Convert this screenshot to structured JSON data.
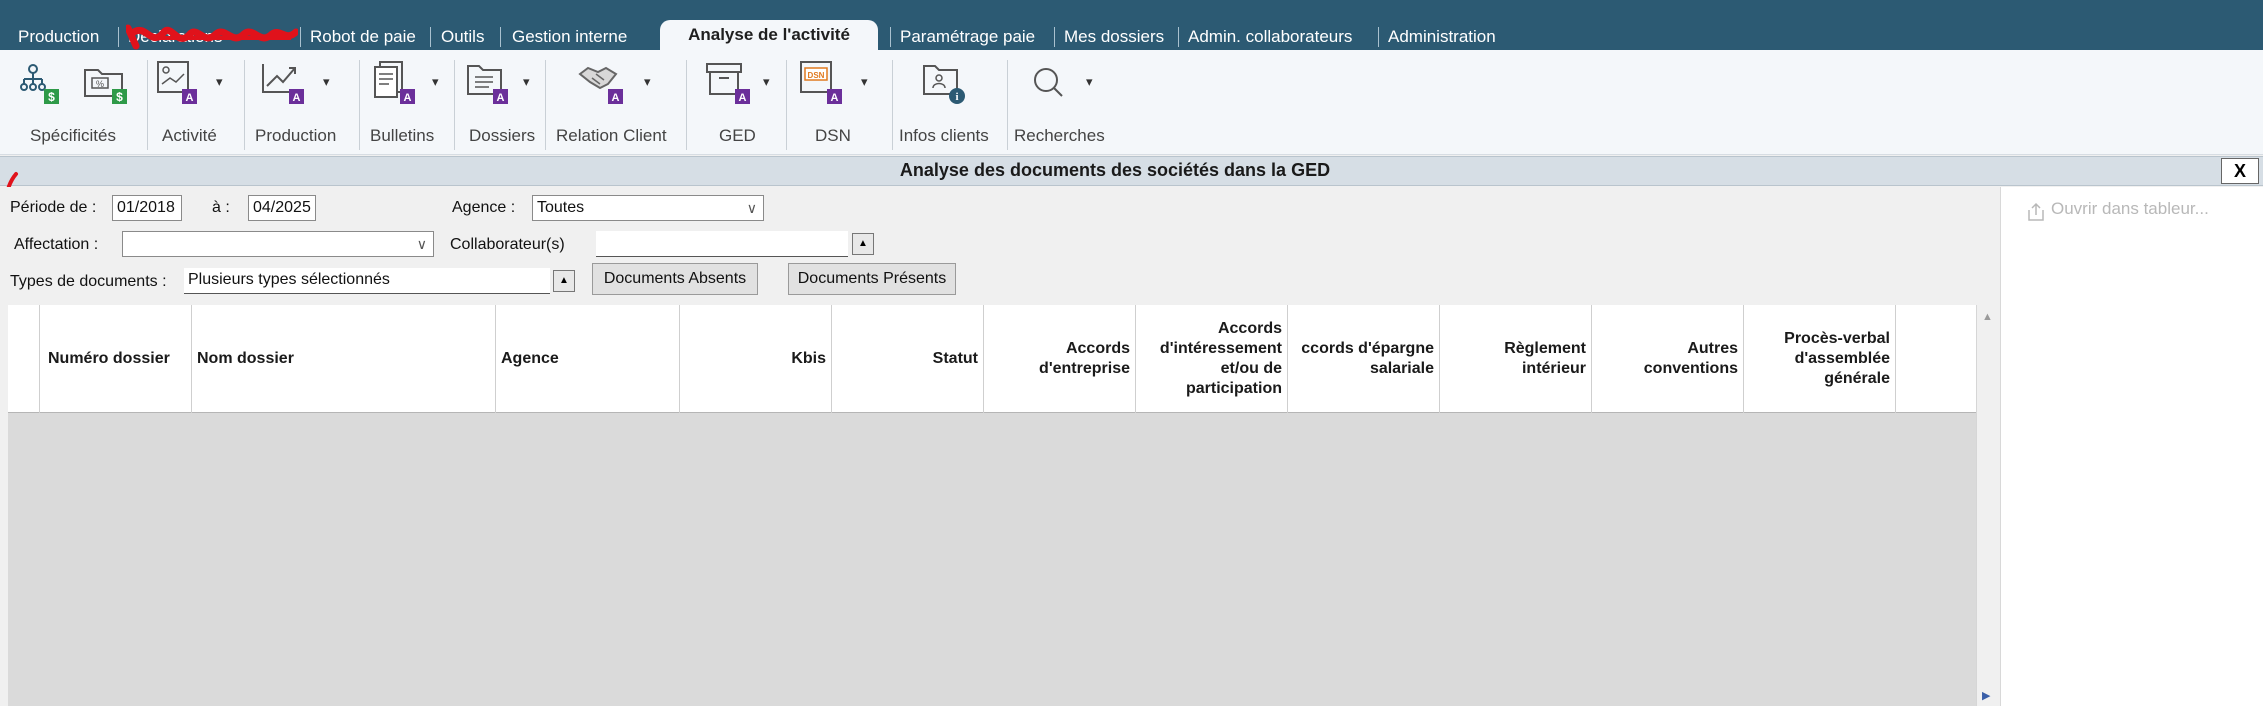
{
  "tabs": [
    {
      "label": "Production",
      "active": false
    },
    {
      "label": "Déclarations",
      "active": false
    },
    {
      "label": "Robot de paie",
      "active": false
    },
    {
      "label": "Outils",
      "active": false
    },
    {
      "label": "Gestion interne",
      "active": false
    },
    {
      "label": "Analyse de l'activité",
      "active": true
    },
    {
      "label": "Paramétrage paie",
      "active": false
    },
    {
      "label": "Mes dossiers",
      "active": false
    },
    {
      "label": "Admin. collaborateurs",
      "active": false
    },
    {
      "label": "Administration",
      "active": false
    }
  ],
  "ribbon": [
    {
      "label": "Spécificités",
      "icons": [
        "org-chart-icon",
        "folder-percent-icon"
      ]
    },
    {
      "label": "Activité",
      "icons": [
        "activity-report-icon"
      ]
    },
    {
      "label": "Production",
      "icons": [
        "chart-line-icon"
      ]
    },
    {
      "label": "Bulletins",
      "icons": [
        "payslip-icon"
      ]
    },
    {
      "label": "Dossiers",
      "icons": [
        "folder-list-icon"
      ]
    },
    {
      "label": "Relation Client",
      "icons": [
        "handshake-icon"
      ]
    },
    {
      "label": "GED",
      "icons": [
        "archive-box-icon"
      ]
    },
    {
      "label": "DSN",
      "icons": [
        "dsn-icon"
      ]
    },
    {
      "label": "Infos clients",
      "icons": [
        "client-info-icon"
      ]
    },
    {
      "label": "Recherches",
      "icons": [
        "search-icon"
      ]
    }
  ],
  "badges": {
    "dollar": "$",
    "admin": "A"
  },
  "title": "Analyse des documents des sociétés dans la GED",
  "close_label": "X",
  "filters": {
    "periode_label": "Période de :",
    "periode_from": "01/2018",
    "a_label": "à :",
    "periode_to": "04/2025",
    "agence_label": "Agence :",
    "agence_value": "Toutes",
    "affectation_label": "Affectation :",
    "affectation_value": "",
    "collaborateurs_label": "Collaborateur(s)",
    "collaborateurs_value": "",
    "types_label": "Types de documents :",
    "types_value": "Plusieurs types sélectionnés",
    "btn_absents": "Documents Absents",
    "btn_presents": "Documents Présents"
  },
  "table": {
    "columns": [
      "",
      "Numéro dossier",
      "Nom dossier",
      "Agence",
      "Kbis",
      "Statut",
      "Accords\nd'entreprise",
      "Accords\nd'intéressement\net/ou de\nparticipation",
      "ccords d'épargne\nsalariale",
      "Règlement\nintérieur",
      "Autres\nconventions",
      "Procès-verbal\nd'assemblée\ngénérale",
      ""
    ],
    "rows": []
  },
  "side_panel": {
    "open_in_sheet": "Ouvrir dans tableur..."
  },
  "colors": {
    "tabbar": "#2c5a73",
    "badge_green": "#2e9a48",
    "badge_purple": "#6b2f9a",
    "annotation_red": "#e0121b"
  }
}
